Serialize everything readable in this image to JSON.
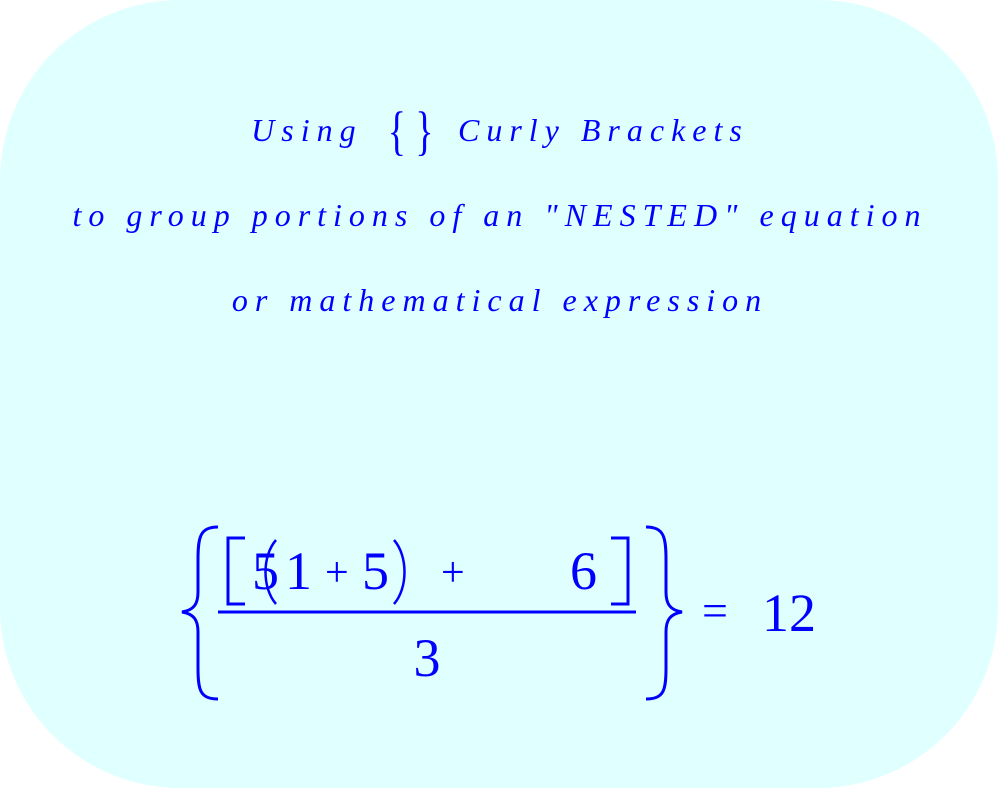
{
  "title": {
    "prefix": "Using",
    "brace_symbol": "{ }",
    "suffix": "Curly Brackets"
  },
  "subtitle_line_1": "to group portions of an \"NESTED\" equation",
  "subtitle_line_2": "or mathematical expression",
  "equation": {
    "numerator_parts": [
      "5",
      "1",
      "+",
      "5",
      "+",
      "6"
    ],
    "numerator_text": "[5(1 + 5) + 6]",
    "denominator": "3",
    "equals": "=",
    "result": "12"
  },
  "colors": {
    "background": "#E0FFFF",
    "text": "#0000FF"
  }
}
